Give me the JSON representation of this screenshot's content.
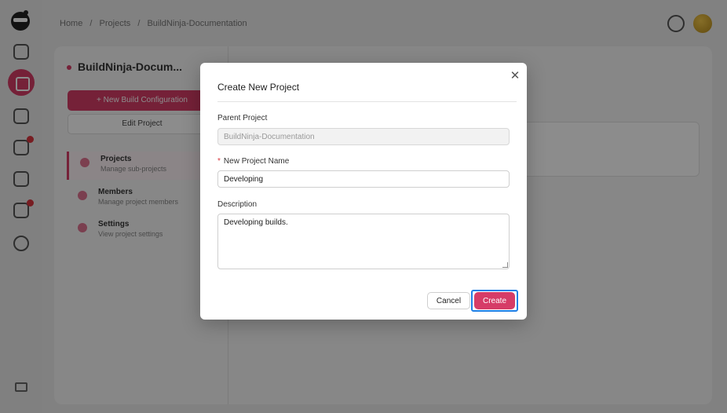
{
  "background": {
    "breadcrumb": [
      "Home",
      "/",
      "Projects",
      "/",
      "BuildNinja-Documentation"
    ],
    "project_title": "BuildNinja-Docum...",
    "new_config_label": "+ New Build Configuration",
    "edit_project_label": "Edit Project",
    "menu": [
      {
        "title": "Projects",
        "subtitle": "Manage sub-projects"
      },
      {
        "title": "Members",
        "subtitle": "Manage project members"
      },
      {
        "title": "Settings",
        "subtitle": "View project settings"
      }
    ]
  },
  "modal": {
    "title": "Create New Project",
    "parent_label": "Parent Project",
    "parent_value": "BuildNinja-Documentation",
    "name_required_mark": "*",
    "name_label": "New Project Name",
    "name_value": "Developing",
    "description_label": "Description",
    "description_value": "Developing builds.",
    "cancel_label": "Cancel",
    "create_label": "Create",
    "close_glyph": "✕"
  },
  "colors": {
    "accent": "#d63c67",
    "focus_outline": "#1e7fe6"
  }
}
